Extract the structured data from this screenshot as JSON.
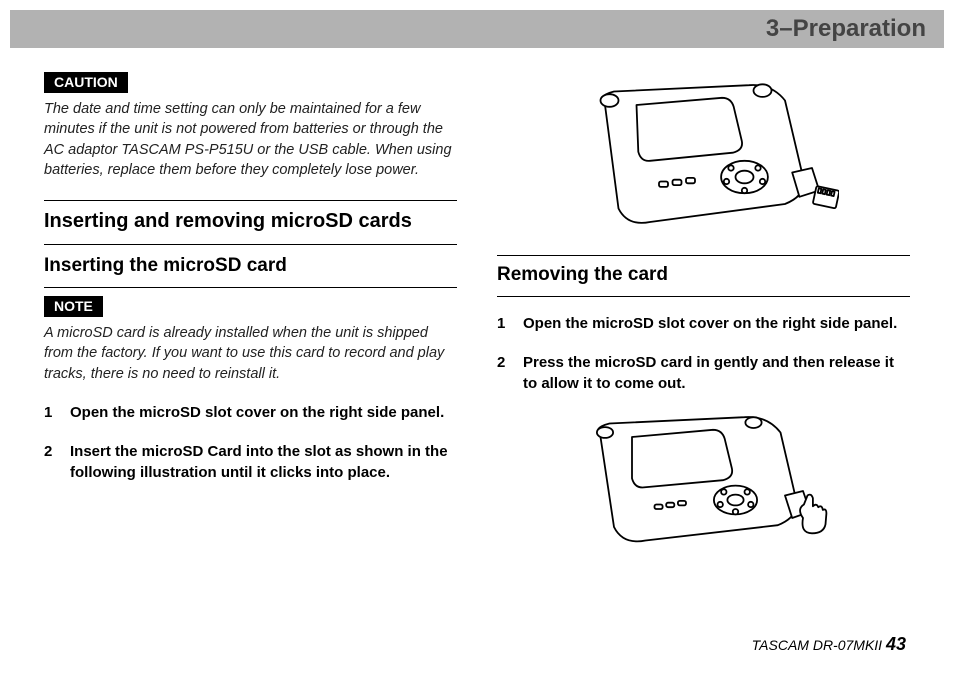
{
  "header": {
    "chapter": "3–Preparation"
  },
  "left": {
    "caution_label": "CAUTION",
    "caution_text": "The date and time setting can only be maintained for a few minutes if the unit is not powered from batteries or through the AC adaptor TASCAM PS-P515U or the USB cable. When using batteries, replace them before they completely lose power.",
    "section_title": "Inserting and removing microSD cards",
    "subsection_title": "Inserting the microSD card",
    "note_label": "NOTE",
    "note_text": "A microSD card is already installed when the unit is shipped from the factory. If you want to use this card to record and play tracks, there is no need to reinstall it.",
    "steps": [
      {
        "n": "1",
        "t": "Open the microSD slot cover on the right side panel."
      },
      {
        "n": "2",
        "t": "Insert the microSD Card into the slot as shown in the following illustration until it clicks into place."
      }
    ]
  },
  "right": {
    "subsection_title": "Removing the card",
    "steps": [
      {
        "n": "1",
        "t": "Open the microSD slot cover on the right side panel."
      },
      {
        "n": "2",
        "t": "Press the microSD card in gently and then release it to allow it to come out."
      }
    ]
  },
  "footer": {
    "model": "TASCAM DR-07MKII",
    "page": "43"
  }
}
